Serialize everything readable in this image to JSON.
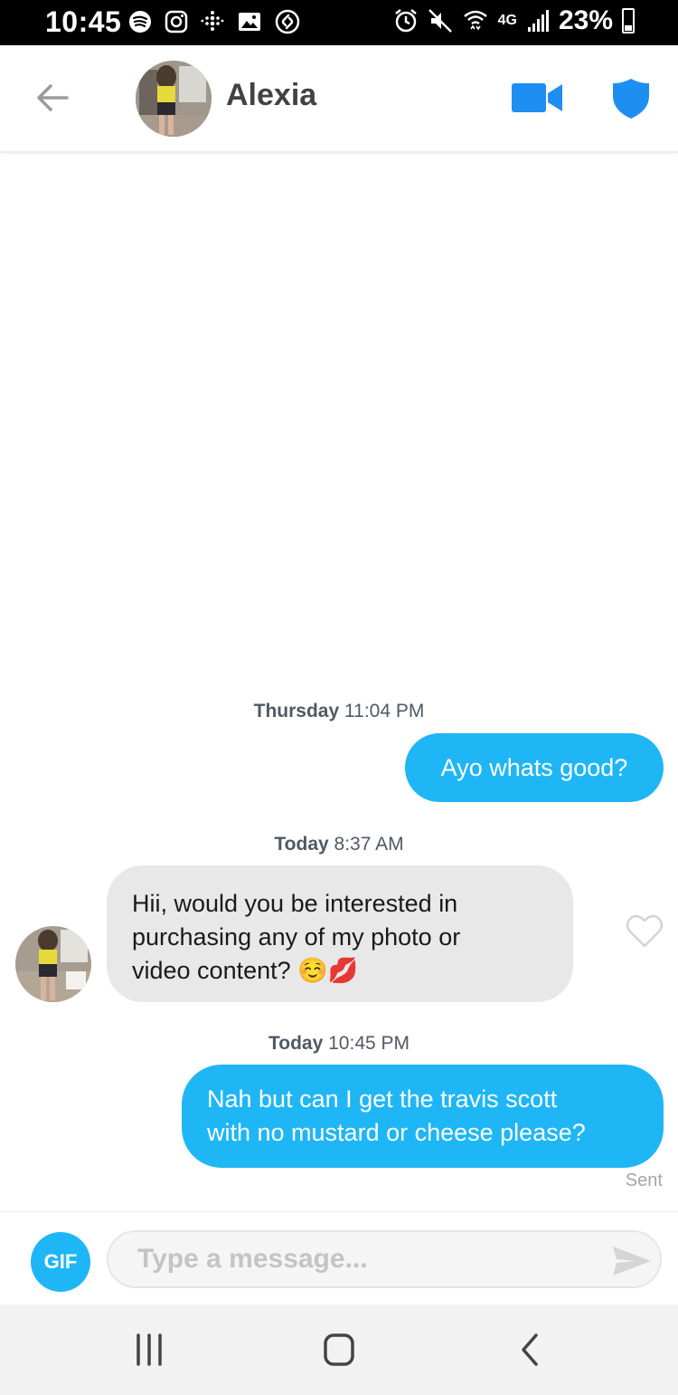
{
  "status_bar": {
    "time": "10:45",
    "network": "4G",
    "battery_percent": "23%",
    "left_icons": [
      "spotify-icon",
      "instagram-icon",
      "fitbit-icon",
      "gallery-icon",
      "shazam-icon"
    ],
    "right_icons": [
      "alarm-icon",
      "mute-icon",
      "wifi-icon",
      "signal-icon",
      "battery-icon"
    ]
  },
  "header": {
    "contact_name": "Alexia",
    "icons": [
      "back-arrow-icon",
      "video-call-icon",
      "safety-shield-icon"
    ]
  },
  "messages": [
    {
      "type": "timestamp",
      "day": "Thursday",
      "time": "11:04 PM"
    },
    {
      "type": "outgoing",
      "lines": [
        "Ayo whats good?"
      ]
    },
    {
      "type": "timestamp",
      "day": "Today",
      "time": "8:37 AM"
    },
    {
      "type": "incoming",
      "lines": [
        "Hii, would you be interested in",
        "purchasing any of my photo or",
        "video content? ☺️💋"
      ]
    },
    {
      "type": "timestamp",
      "day": "Today",
      "time": "10:45 PM"
    },
    {
      "type": "outgoing",
      "lines": [
        "Nah but can I get the travis scott",
        "with no mustard or cheese please?"
      ]
    }
  ],
  "status": {
    "sent_label": "Sent"
  },
  "composer": {
    "gif_label": "GIF",
    "placeholder": "Type a message...",
    "value": ""
  },
  "colors": {
    "accent": "#1fb6f5",
    "incoming_bubble": "#e8e8e8",
    "header_icon": "#1f8ef1"
  }
}
